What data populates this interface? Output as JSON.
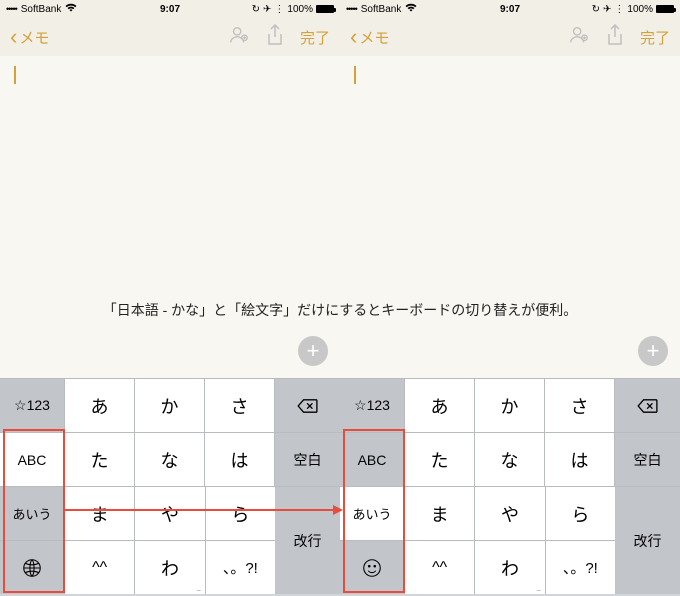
{
  "status": {
    "carrier": "SoftBank",
    "time": "9:07",
    "battery": "100%",
    "signal": "•••••"
  },
  "nav": {
    "back": "メモ",
    "done": "完了"
  },
  "caption": "「日本語 - かな」と「絵文字」だけにするとキーボードの切り替えが便利。",
  "keys": {
    "r1": {
      "side": "☆123",
      "c1": "あ",
      "c2": "か",
      "c3": "さ"
    },
    "r2": {
      "side": "ABC",
      "c1": "た",
      "c2": "な",
      "c3": "は",
      "right": "空白"
    },
    "r3": {
      "side": "あいう",
      "c1": "ま",
      "c2": "や",
      "c3": "ら",
      "right": "改行"
    },
    "r4": {
      "c1": "^^",
      "c2": "わ",
      "c3": "、。?!"
    }
  },
  "left": {
    "r4side": "globe"
  },
  "right": {
    "r4side": "emoji"
  }
}
